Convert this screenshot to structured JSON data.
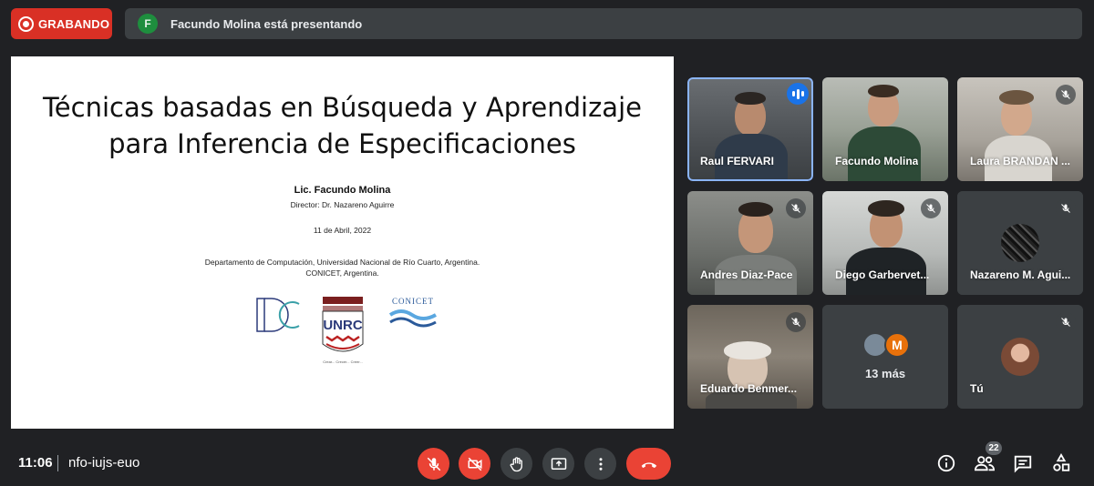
{
  "recording": {
    "label": "GRABANDO"
  },
  "presenter_bar": {
    "avatar_letter": "F",
    "text": "Facundo Molina está presentando"
  },
  "slide": {
    "title_line1": "Técnicas basadas en Búsqueda y Aprendizaje",
    "title_line2": "para Inferencia de Especificaciones",
    "author": "Lic. Facundo Molina",
    "director": "Director: Dr. Nazareno Aguirre",
    "date": "11 de Abril, 2022",
    "affiliation_line1": "Departamento de Computación, Universidad Nacional de Río Cuarto, Argentina.",
    "affiliation_line2": "CONICET, Argentina.",
    "logo_unrc": "UNRC",
    "logo_conicet": "CONICET",
    "logo_unrc_motto": "Crear... Crecer... Creer..."
  },
  "participants": [
    {
      "name": "Raul FERVARI",
      "state": "speaking"
    },
    {
      "name": "Facundo Molina",
      "state": "unmuted"
    },
    {
      "name": "Laura BRANDAN ...",
      "state": "muted"
    },
    {
      "name": "Andres Diaz-Pace",
      "state": "muted"
    },
    {
      "name": "Diego Garbervet...",
      "state": "muted"
    },
    {
      "name": "Nazareno M. Agui...",
      "state": "muted"
    },
    {
      "name": "Eduardo Benmer...",
      "state": "muted"
    },
    {
      "name": "",
      "state": "overflow"
    },
    {
      "name": "Tú",
      "state": "muted"
    }
  ],
  "overflow": {
    "label": "13 más",
    "avatar_letter": "M"
  },
  "bottom": {
    "time": "11:06",
    "meeting_code": "nfo-iujs-euo",
    "participant_count": "22"
  },
  "colors": {
    "accent": "#8ab4f8",
    "danger": "#ea4335",
    "background": "#202124",
    "surface": "#3c4043"
  }
}
